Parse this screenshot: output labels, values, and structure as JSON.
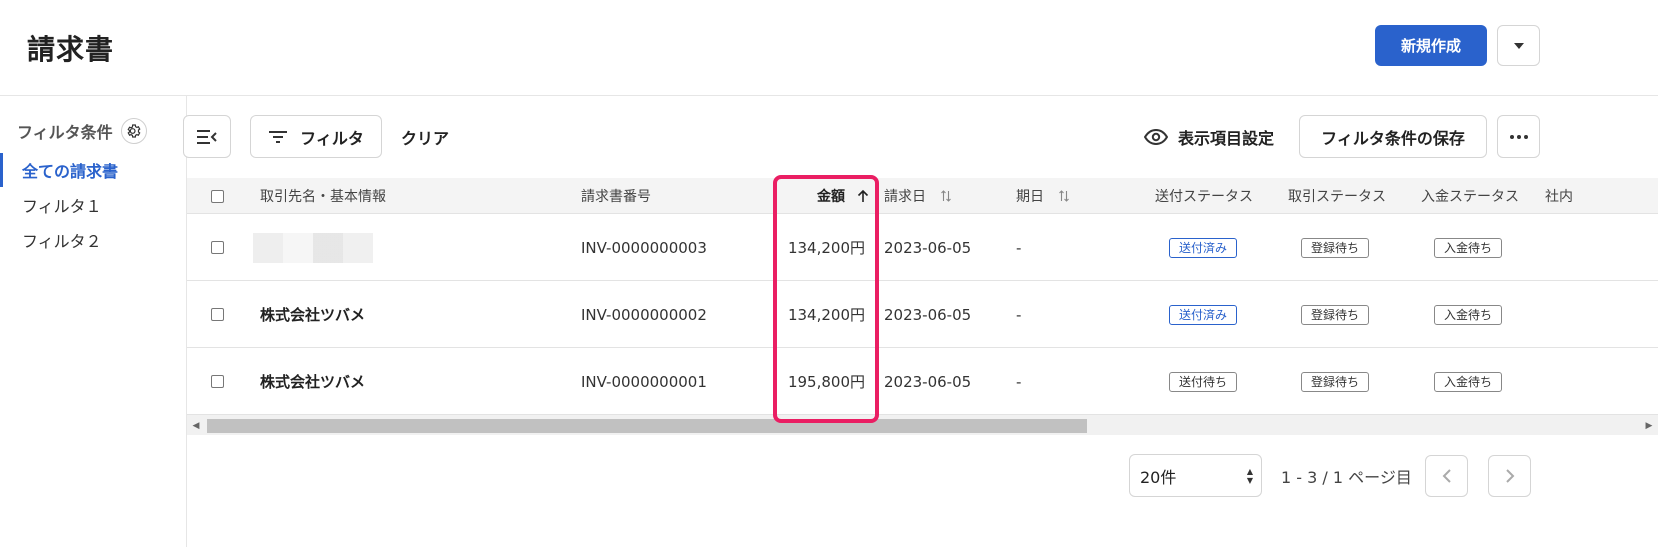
{
  "header": {
    "title": "請求書",
    "new_button": "新規作成"
  },
  "sidebar": {
    "heading": "フィルタ条件",
    "items": [
      {
        "label": "全ての請求書",
        "active": true
      },
      {
        "label": "フィルタ１",
        "active": false
      },
      {
        "label": "フィルタ２",
        "active": false
      }
    ]
  },
  "toolbar": {
    "filter_label": "フィルタ",
    "clear_label": "クリア",
    "display_settings_label": "表示項目設定",
    "save_filter_label": "フィルタ条件の保存"
  },
  "table": {
    "columns": {
      "client": "取引先名・基本情報",
      "invoice_no": "請求書番号",
      "amount": "金額",
      "invoice_date": "請求日",
      "due_date": "期日",
      "send_status": "送付ステータス",
      "deal_status": "取引ステータス",
      "payment_status": "入金ステータス",
      "extra": "社内"
    },
    "rows": [
      {
        "client": "",
        "invoice_no": "INV-0000000003",
        "amount": "134,200円",
        "invoice_date": "2023-06-05",
        "due_date": "-",
        "send_status": "送付済み",
        "deal_status": "登録待ち",
        "payment_status": "入金待ち"
      },
      {
        "client": "株式会社ツバメ",
        "invoice_no": "INV-0000000002",
        "amount": "134,200円",
        "invoice_date": "2023-06-05",
        "due_date": "-",
        "send_status": "送付済み",
        "deal_status": "登録待ち",
        "payment_status": "入金待ち"
      },
      {
        "client": "株式会社ツバメ",
        "invoice_no": "INV-0000000001",
        "amount": "195,800円",
        "invoice_date": "2023-06-05",
        "due_date": "-",
        "send_status": "送付待ち",
        "deal_status": "登録待ち",
        "payment_status": "入金待ち"
      }
    ]
  },
  "pagination": {
    "per_page": "20件",
    "info": "1 - 3 / 1 ページ目"
  },
  "colors": {
    "accent": "#2a62cc",
    "highlight": "#ea1e63"
  }
}
